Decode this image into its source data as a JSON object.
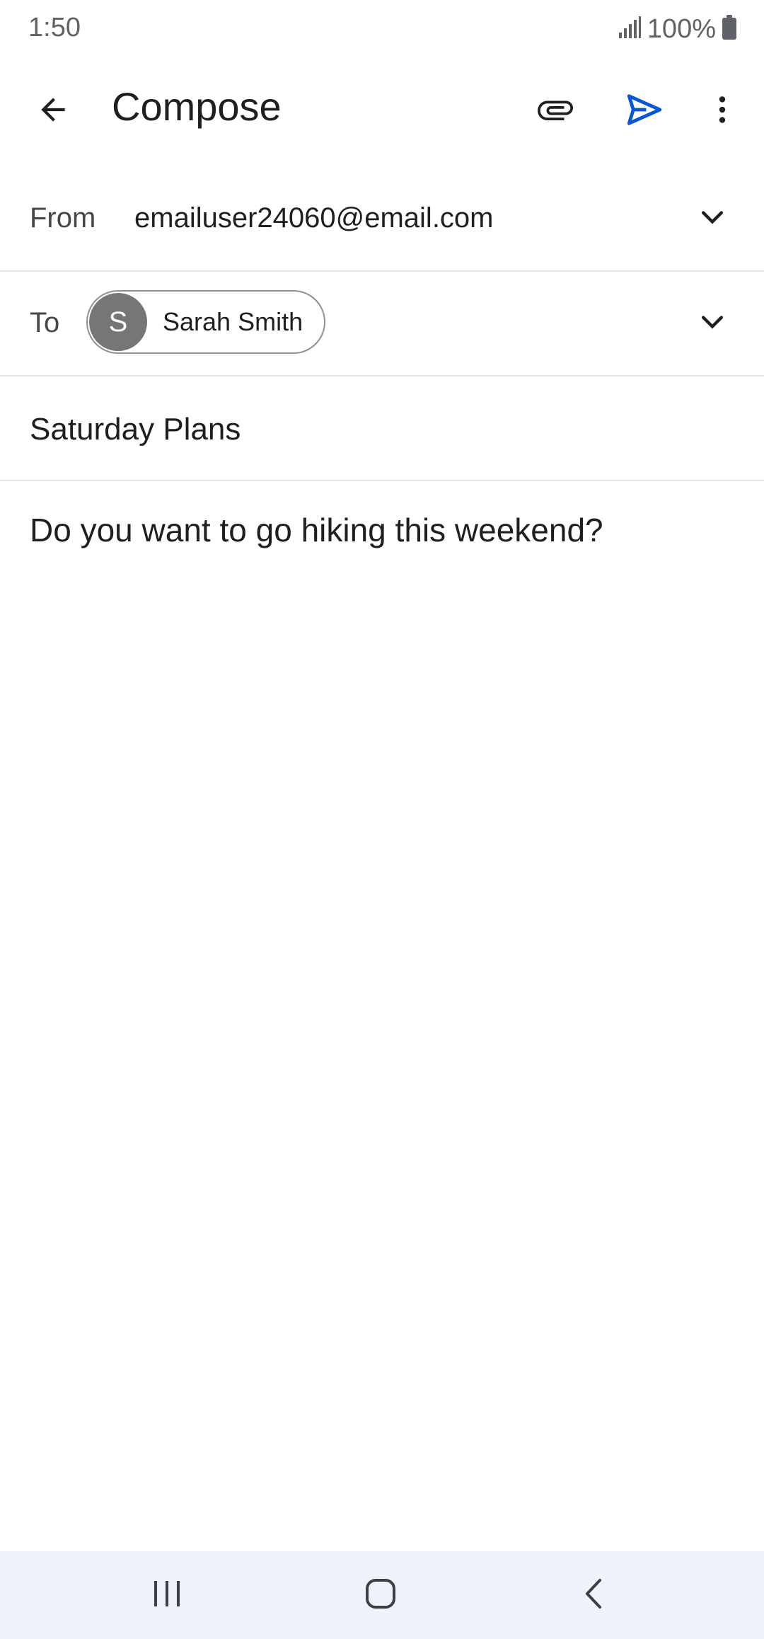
{
  "status_bar": {
    "time": "1:50",
    "battery": "100%",
    "icons": [
      "signal-icon",
      "battery-icon"
    ]
  },
  "app_bar": {
    "title": "Compose",
    "icons": [
      "back-arrow-icon",
      "attachment-icon",
      "send-icon",
      "more-vert-icon"
    ],
    "accent_color": "#0b57d0"
  },
  "from_row": {
    "label": "From",
    "value": "emailuser24060@email.com"
  },
  "to_row": {
    "label": "To",
    "recipient": {
      "initial": "S",
      "name": "Sarah Smith"
    }
  },
  "subject": "Saturday Plans",
  "body": "Do you want to go hiking this weekend?",
  "nav_bar": {
    "icons": [
      "recents-icon",
      "home-icon",
      "nav-back-icon"
    ]
  }
}
